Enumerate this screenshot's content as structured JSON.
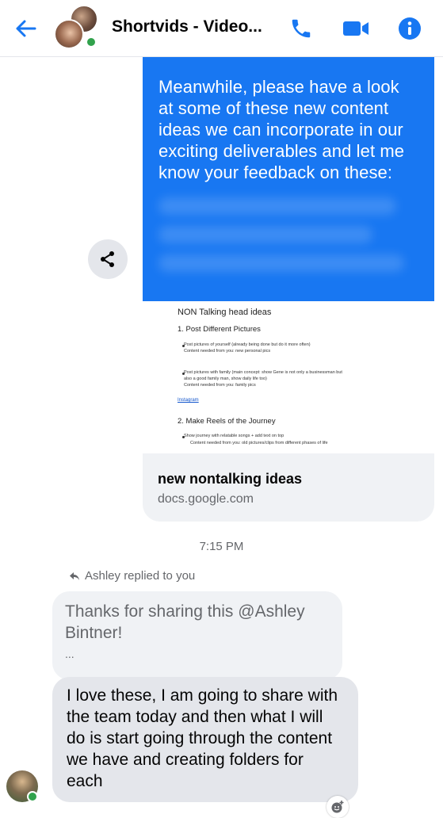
{
  "header": {
    "title": "Shortvids - Video...",
    "icons": [
      "back-arrow-icon",
      "phone-icon",
      "video-camera-icon",
      "info-icon"
    ],
    "accent_color": "#1877f2"
  },
  "thread": {
    "outgoing_message": {
      "text": "Meanwhile, please have a look at some of these new content ideas we can incorporate in our exciting deliverables and let me know your feedback on these:",
      "color": "#1877f2"
    },
    "link_preview": {
      "doc_heading": "NON Talking head ideas",
      "section_1": "1. Post Different Pictures",
      "bullet_1_line_1": "Post pictures of yourself (already being done but do it more often)",
      "bullet_1_line_2": "Content needed from you: new personal pics",
      "bullet_2_line_1": "Post pictures with family (main concept: show Gene is not only a businessman but",
      "bullet_2_line_2": "also a good family man, show daily life too)",
      "bullet_2_line_3": "Content needed from you: family pics",
      "platform_link": "Instagram",
      "section_2": "2. Make Reels of the Journey",
      "bullet_3_line_1": "Show journey with relatable songs + add text on top",
      "bullet_3_line_2": "Content needed from you: old pictures/clips from different phases of life",
      "title": "new nontalking ideas",
      "domain": "docs.google.com"
    },
    "timestamp": "7:15 PM",
    "reply_label": "Ashley replied to you",
    "quoted_message": {
      "text": "Thanks for sharing this @Ashley Bintner!",
      "ellipsis": "..."
    },
    "incoming_message": {
      "text": "I love these, I am going to share with the team today and then what I will do is start going through the content we have and creating folders for each"
    }
  }
}
